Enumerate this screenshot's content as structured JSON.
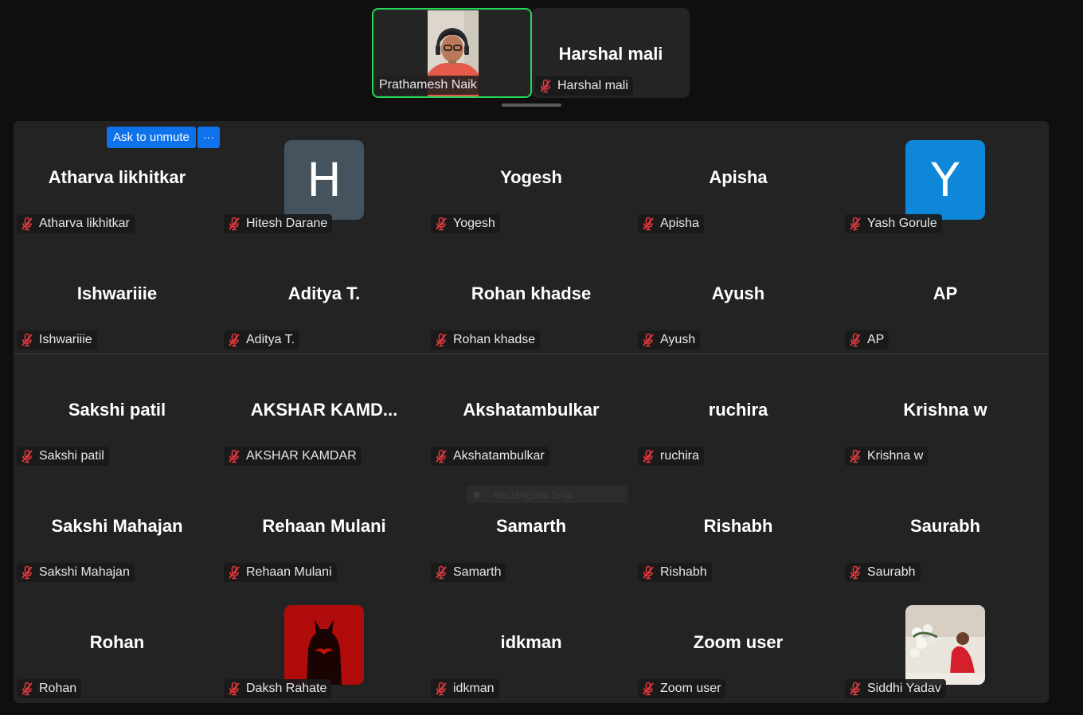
{
  "filmstrip": {
    "active_speaker": {
      "name": "Prathamesh Naik"
    },
    "second": {
      "display_name": "Harshal mali",
      "label": "Harshal mali"
    }
  },
  "controls": {
    "ask_to_unmute": "Ask to unmute",
    "more": "···"
  },
  "snip_overlay": {
    "text": "Rectangular Snip"
  },
  "colors": {
    "active_border": "#23d959",
    "button_blue": "#0e72ed",
    "mute_red": "#e0393e"
  },
  "participants": [
    {
      "display": "Atharva likhitkar",
      "label": "Atharva likhitkar"
    },
    {
      "display": "H",
      "label": "Hitesh Darane",
      "avatar": "letter",
      "avatar_color": "#45535e"
    },
    {
      "display": "Yogesh",
      "label": "Yogesh"
    },
    {
      "display": "Apisha",
      "label": "Apisha"
    },
    {
      "display": "Y",
      "label": "Yash Gorule",
      "avatar": "letter",
      "avatar_color": "#0e87d8"
    },
    {
      "display": "Ishwariiie",
      "label": "Ishwariiie"
    },
    {
      "display": "Aditya T.",
      "label": "Aditya T."
    },
    {
      "display": "Rohan khadse",
      "label": "Rohan khadse"
    },
    {
      "display": "Ayush",
      "label": "Ayush"
    },
    {
      "display": "AP",
      "label": "AP"
    },
    {
      "display": "Sakshi patil",
      "label": "Sakshi patil"
    },
    {
      "display": "AKSHAR  KAMD...",
      "label": "AKSHAR KAMDAR"
    },
    {
      "display": "Akshatambulkar",
      "label": "Akshatambulkar"
    },
    {
      "display": "ruchira",
      "label": "ruchira"
    },
    {
      "display": "Krishna w",
      "label": "Krishna w"
    },
    {
      "display": "Sakshi Mahajan",
      "label": "Sakshi Mahajan"
    },
    {
      "display": "Rehaan Mulani",
      "label": "Rehaan Mulani"
    },
    {
      "display": "Samarth",
      "label": "Samarth"
    },
    {
      "display": "Rishabh",
      "label": "Rishabh"
    },
    {
      "display": "Saurabh",
      "label": "Saurabh"
    },
    {
      "display": "Rohan",
      "label": "Rohan"
    },
    {
      "display": "",
      "label": "Daksh Rahate",
      "avatar": "batman-image"
    },
    {
      "display": "idkman",
      "label": "idkman"
    },
    {
      "display": "Zoom user",
      "label": "Zoom user"
    },
    {
      "display": "",
      "label": "Siddhi  Yadav",
      "avatar": "photo-image"
    }
  ]
}
